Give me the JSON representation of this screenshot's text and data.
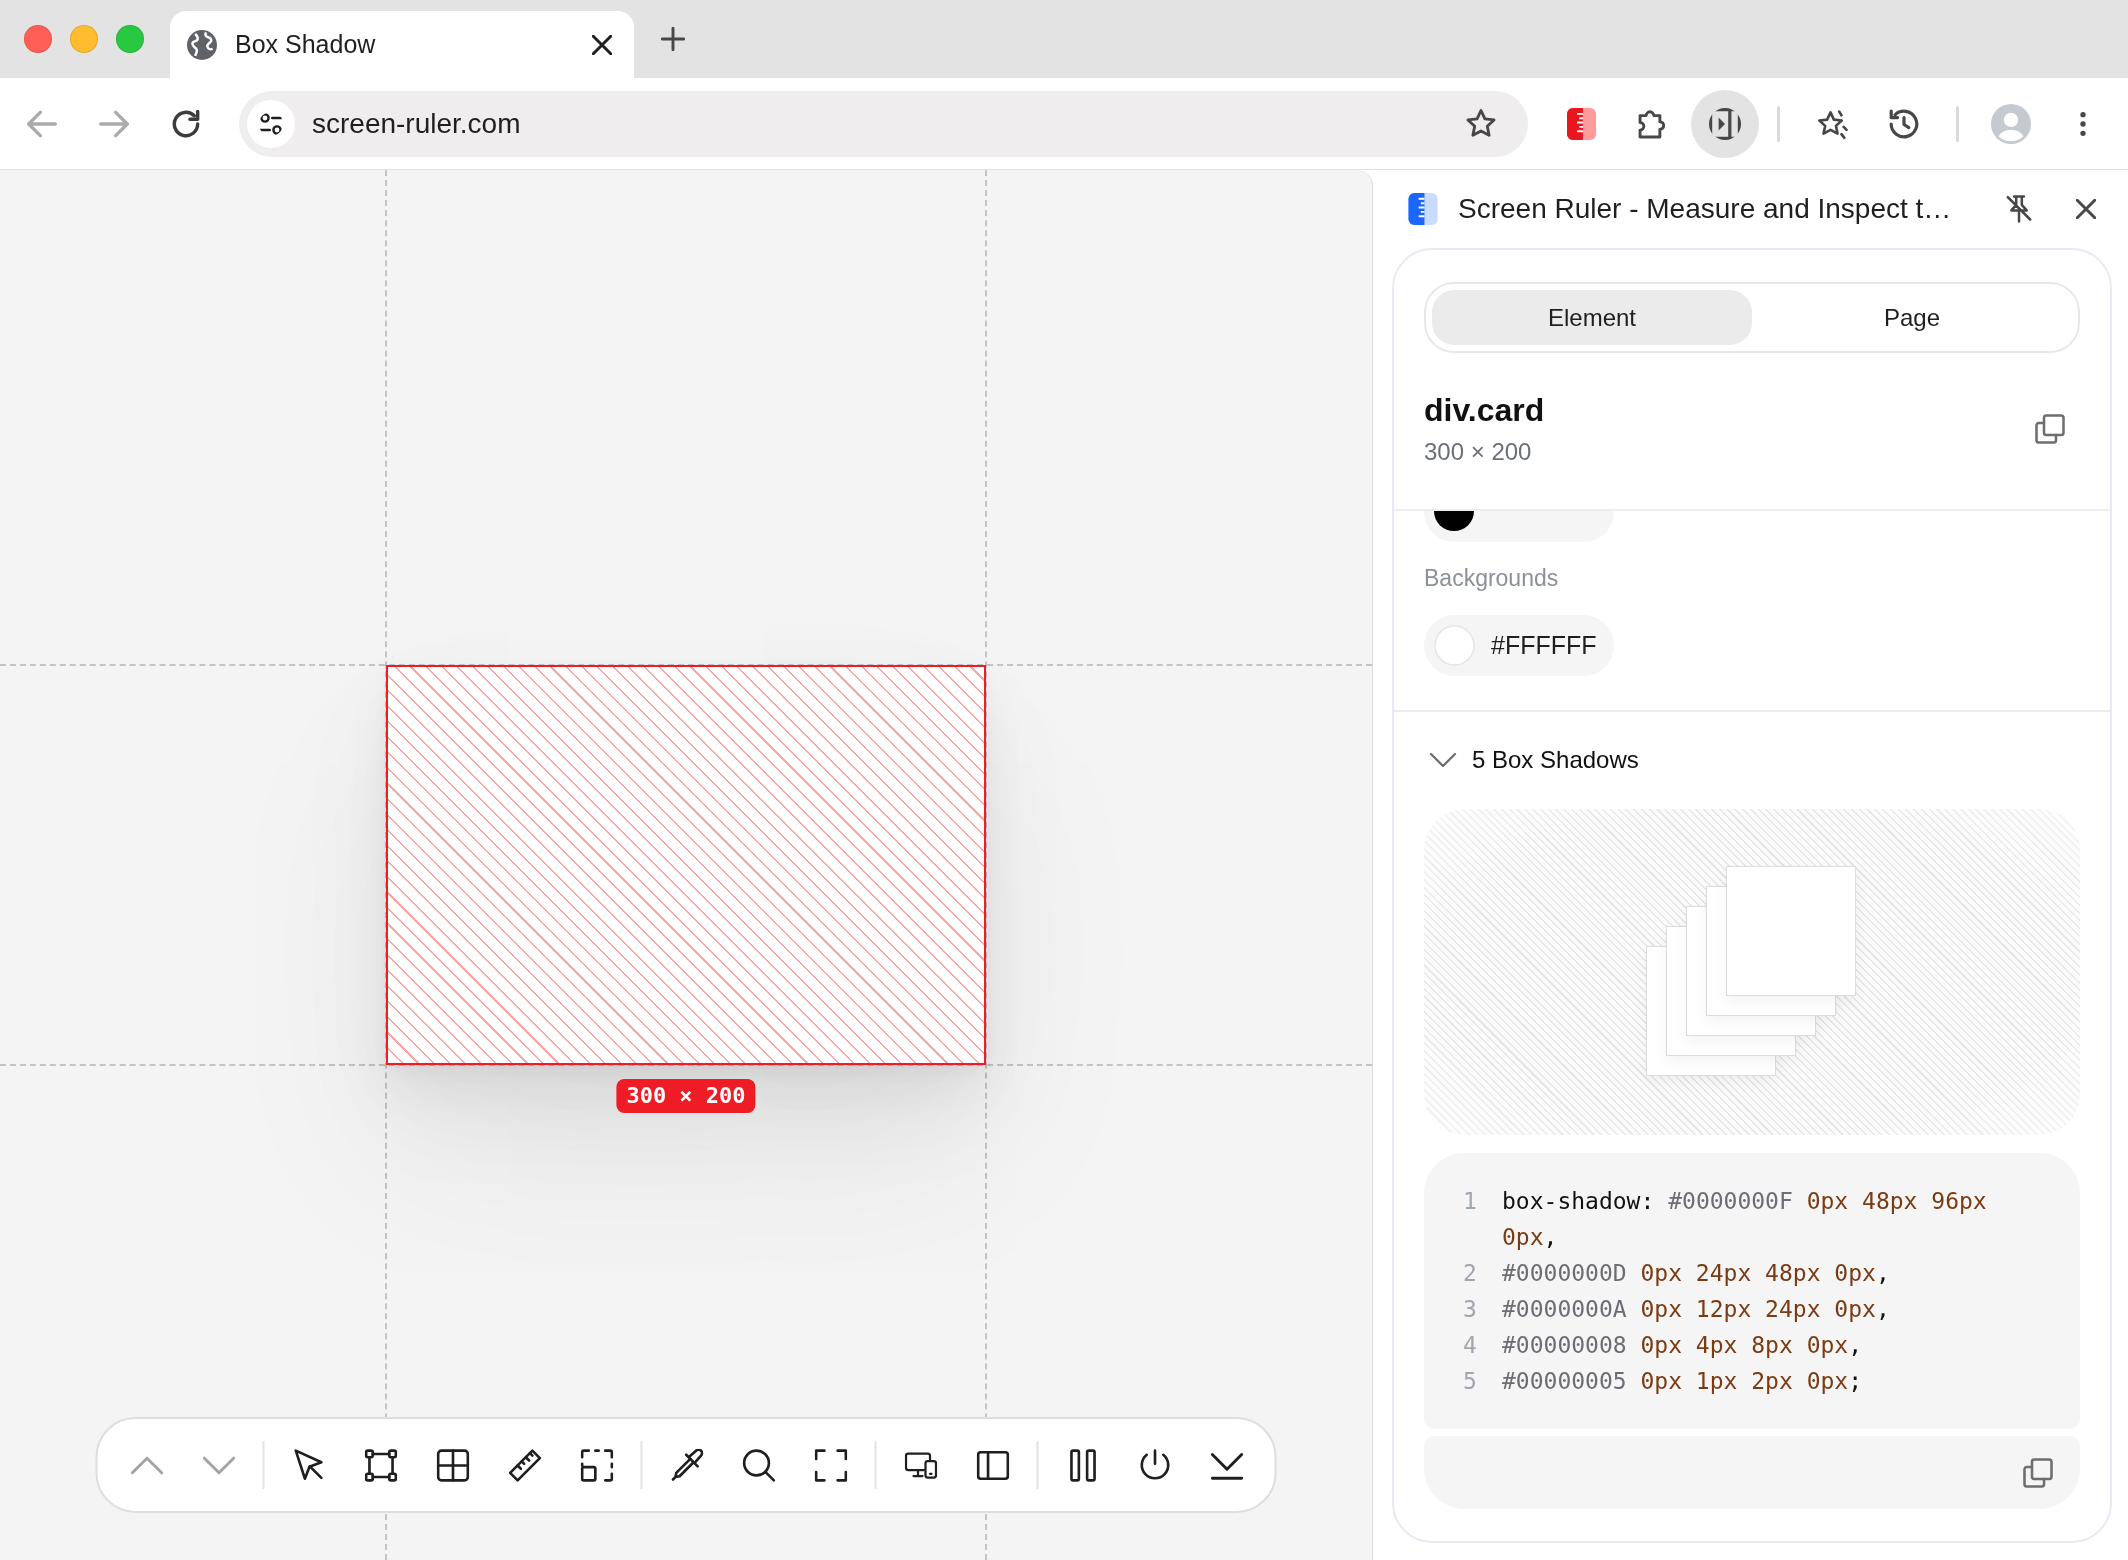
{
  "browser": {
    "window_controls": [
      {
        "color": "#ff5f57"
      },
      {
        "color": "#febc2e"
      },
      {
        "color": "#28c840"
      }
    ],
    "tabs": [
      {
        "title": "Box Shadow",
        "selected": true
      }
    ],
    "nav_buttons": [
      {
        "disabled": true
      },
      {
        "disabled": true
      },
      {
        "disabled": false
      }
    ],
    "address_bar": {
      "url": "screen-ruler.com"
    },
    "toolbar_groups": [
      [
        {
          "active": false
        },
        {
          "active": false
        },
        {
          "active": true
        }
      ],
      [
        {
          "active": false
        },
        {
          "active": false
        }
      ],
      [
        {
          "active": false
        },
        {
          "active": false
        }
      ]
    ]
  },
  "canvas": {
    "size_label": "300 × 200",
    "toolbar_groups": [
      [
        {
          "disabled": true
        },
        {
          "disabled": true
        }
      ],
      [
        {
          "disabled": false
        },
        {
          "disabled": false
        },
        {
          "disabled": false
        },
        {
          "disabled": false
        },
        {
          "disabled": false
        }
      ],
      [
        {
          "disabled": false
        },
        {
          "disabled": false
        },
        {
          "disabled": false
        }
      ],
      [
        {
          "disabled": false
        },
        {
          "disabled": false
        }
      ],
      [
        {
          "disabled": false
        },
        {
          "disabled": false
        },
        {
          "disabled": false
        }
      ]
    ]
  },
  "side_panel": {
    "title": "Screen Ruler - Measure and Inspect t…",
    "segments": [
      {
        "label": "Element",
        "selected": true
      },
      {
        "label": "Page",
        "selected": false
      }
    ],
    "element": {
      "name": "div.card",
      "size": "300 × 200"
    },
    "property_groups": [
      {
        "chips": [
          {
            "color": "#000000"
          }
        ]
      },
      {
        "title": "Backgrounds",
        "chips": [
          {
            "color": "#ffffff",
            "label": "#FFFFFF"
          }
        ]
      }
    ],
    "box_shadows": {
      "title": "5 Box Shadows",
      "expanded": true,
      "code_lines": [
        {
          "number": "1",
          "tokens": [
            {
              "kind": "property",
              "text": "box-shadow:"
            },
            {
              "kind": "hex",
              "text": "#0000000F"
            },
            {
              "kind": "number",
              "text": "0px 48px 96px 0px"
            },
            {
              "kind": "punctuation",
              "text": ","
            }
          ]
        },
        {
          "number": "2",
          "tokens": [
            {
              "kind": "hex",
              "text": "#0000000D"
            },
            {
              "kind": "number",
              "text": "0px 24px 48px 0px"
            },
            {
              "kind": "punctuation",
              "text": ","
            }
          ]
        },
        {
          "number": "3",
          "tokens": [
            {
              "kind": "hex",
              "text": "#0000000A"
            },
            {
              "kind": "number",
              "text": "0px 12px 24px 0px"
            },
            {
              "kind": "punctuation",
              "text": ","
            }
          ]
        },
        {
          "number": "4",
          "tokens": [
            {
              "kind": "hex",
              "text": "#00000008"
            },
            {
              "kind": "number",
              "text": "0px 4px 8px 0px"
            },
            {
              "kind": "punctuation",
              "text": ","
            }
          ]
        },
        {
          "number": "5",
          "tokens": [
            {
              "kind": "hex",
              "text": "#00000005"
            },
            {
              "kind": "number",
              "text": "0px 1px 2px 0px"
            },
            {
              "kind": "punctuation",
              "text": ";"
            }
          ]
        }
      ]
    }
  }
}
